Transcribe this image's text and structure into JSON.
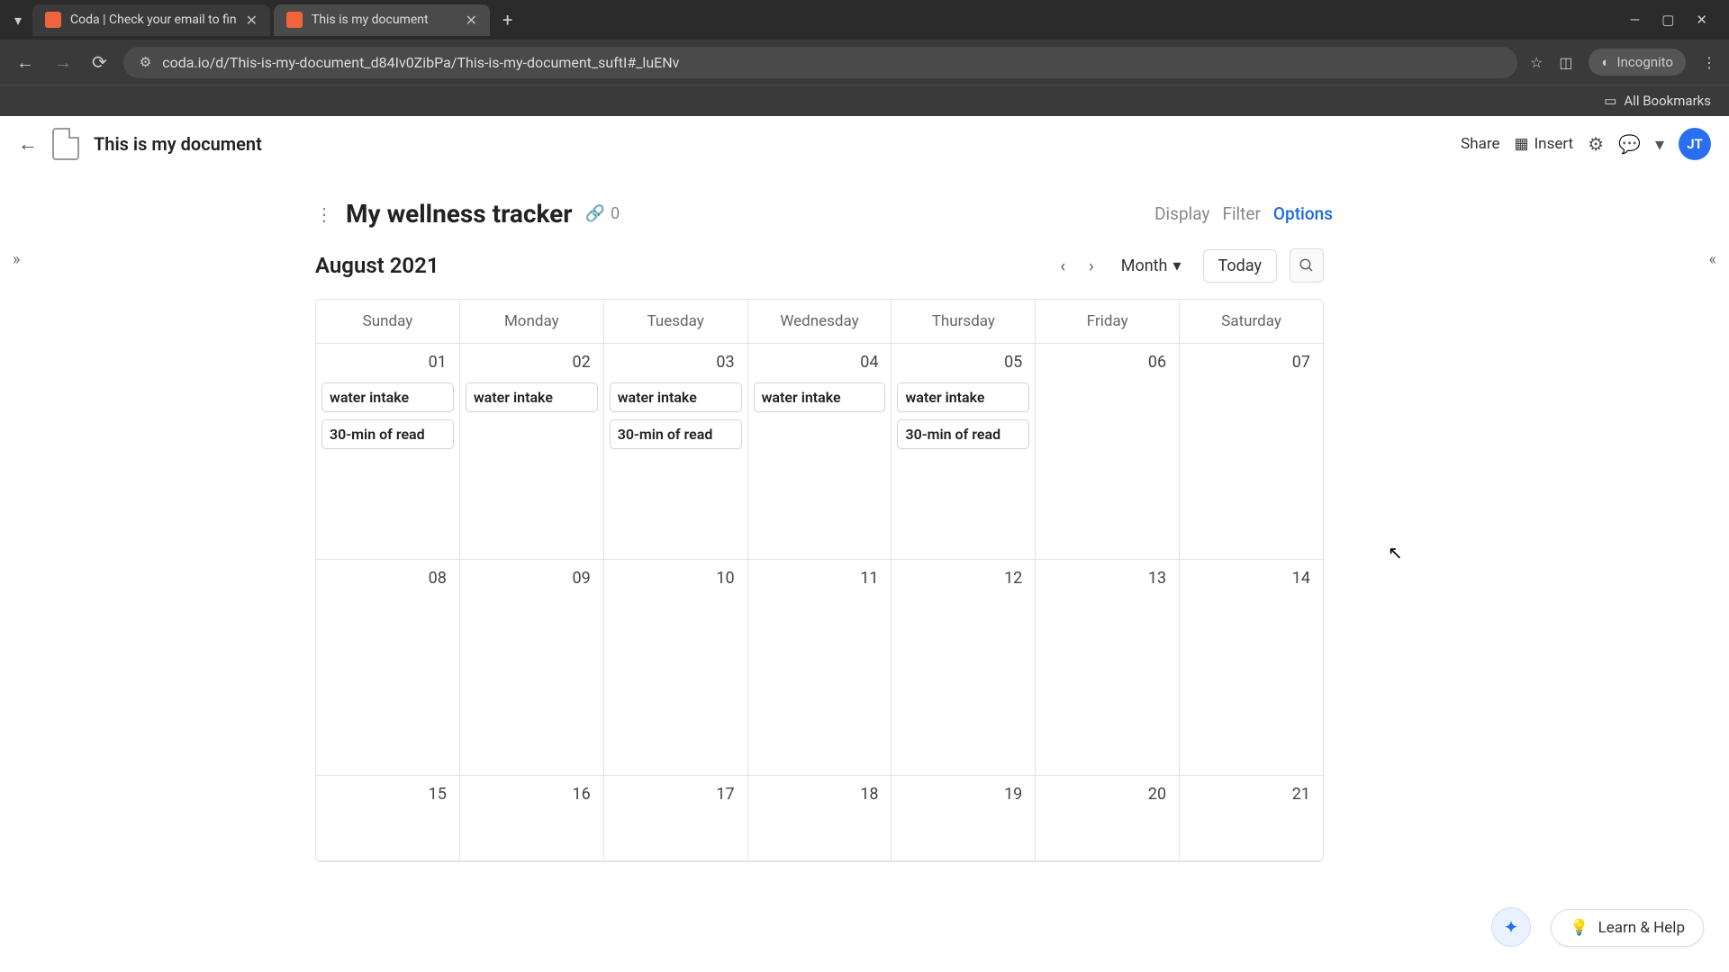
{
  "browser": {
    "tabs": [
      {
        "title": "Coda | Check your email to fin",
        "active": false
      },
      {
        "title": "This is my document",
        "active": true
      }
    ],
    "url": "coda.io/d/This-is-my-document_d84Iv0ZibPa/This-is-my-document_suftI#_luENv",
    "incognito_label": "Incognito",
    "all_bookmarks": "All Bookmarks"
  },
  "header": {
    "doc_title": "This is my document",
    "share": "Share",
    "insert": "Insert",
    "avatar": "JT"
  },
  "tracker": {
    "title": "My wellness tracker",
    "link_count": "0",
    "tabs": {
      "display": "Display",
      "filter": "Filter",
      "options": "Options"
    }
  },
  "calendar": {
    "month_label": "August 2021",
    "view_select": "Month",
    "today": "Today",
    "day_headers": [
      "Sunday",
      "Monday",
      "Tuesday",
      "Wednesday",
      "Thursday",
      "Friday",
      "Saturday"
    ],
    "weeks": [
      {
        "days": [
          {
            "num": "01",
            "events": [
              "water intake",
              "30-min of read"
            ]
          },
          {
            "num": "02",
            "events": [
              "water intake"
            ]
          },
          {
            "num": "03",
            "events": [
              "water intake",
              "30-min of read"
            ]
          },
          {
            "num": "04",
            "events": [
              "water intake"
            ]
          },
          {
            "num": "05",
            "events": [
              "water intake",
              "30-min of read"
            ]
          },
          {
            "num": "06",
            "events": []
          },
          {
            "num": "07",
            "events": []
          }
        ]
      },
      {
        "days": [
          {
            "num": "08",
            "events": []
          },
          {
            "num": "09",
            "events": []
          },
          {
            "num": "10",
            "events": []
          },
          {
            "num": "11",
            "events": []
          },
          {
            "num": "12",
            "events": []
          },
          {
            "num": "13",
            "events": []
          },
          {
            "num": "14",
            "events": []
          }
        ]
      },
      {
        "days": [
          {
            "num": "15",
            "events": []
          },
          {
            "num": "16",
            "events": []
          },
          {
            "num": "17",
            "events": []
          },
          {
            "num": "18",
            "events": []
          },
          {
            "num": "19",
            "events": []
          },
          {
            "num": "20",
            "events": []
          },
          {
            "num": "21",
            "events": []
          }
        ]
      }
    ]
  },
  "footer": {
    "learn_help": "Learn & Help"
  }
}
